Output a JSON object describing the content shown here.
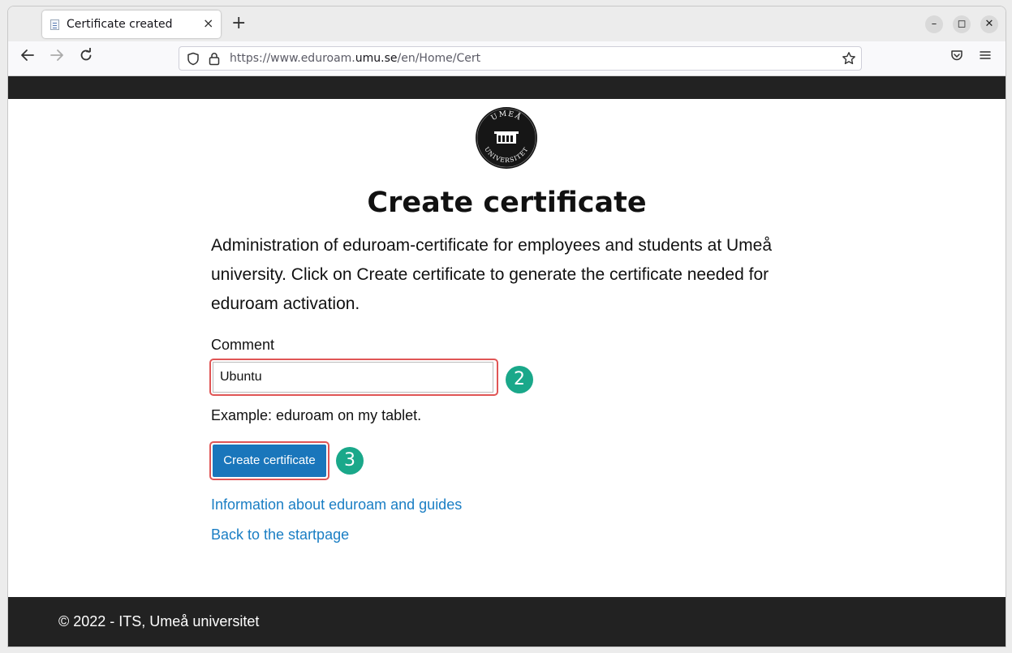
{
  "browser": {
    "tab_title": "Certificate created",
    "tab_close": "×",
    "new_tab": "+",
    "url_prefix": "https://www.eduroam.",
    "url_domain": "umu.se",
    "url_path": "/en/Home/Cert",
    "window_buttons": [
      "–",
      "◻",
      "✕"
    ]
  },
  "logo": {
    "text_top": "UMEÅ",
    "text_bottom": "UNIVERSITET"
  },
  "page": {
    "title": "Create certificate",
    "intro": "Administration of eduroam-certificate for employees and students at Umeå university. Click on Create certificate to generate the certificate needed for eduroam activation.",
    "comment_label": "Comment",
    "comment_value": "Ubuntu",
    "example": "Example: eduroam on my tablet.",
    "create_button": "Create certificate",
    "link_info": "Information about eduroam and guides",
    "link_back": "Back to the startpage"
  },
  "annotations": {
    "badge_input": "2",
    "badge_button": "3",
    "highlight_color": "#e05555",
    "badge_color": "#1aa88a"
  },
  "footer": {
    "text": "© 2022 - ITS, Umeå universitet"
  }
}
